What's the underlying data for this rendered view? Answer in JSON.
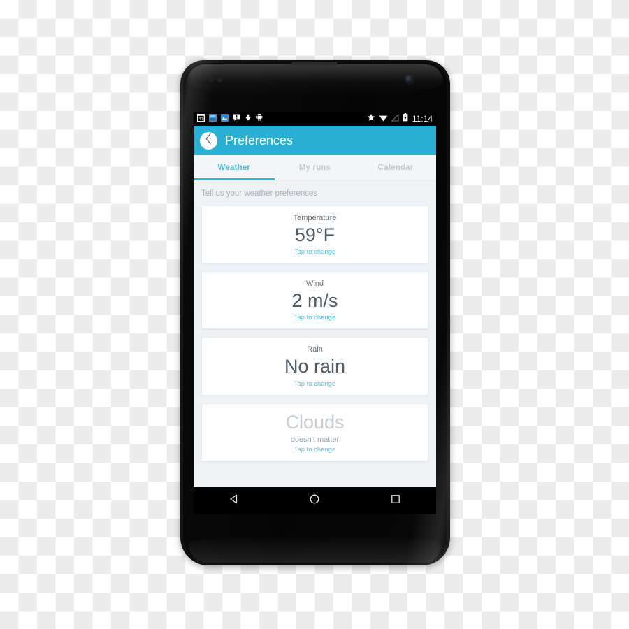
{
  "device": {
    "type": "android-smartphone",
    "earpiece": "earpiece-speaker",
    "camera": "front-camera"
  },
  "statusbar": {
    "clock": "11:14",
    "left_icons": [
      "calendar-icon",
      "download-manager-icon",
      "photos-icon",
      "alert-message-icon",
      "download-arrow-icon",
      "android-robot-icon"
    ],
    "right_icons": [
      "star-icon",
      "wifi-icon",
      "signal-icon",
      "battery-charging-icon"
    ]
  },
  "appbar": {
    "back_icon": "chevron-left-icon",
    "title": "Preferences",
    "accent_color": "#29b0d4"
  },
  "tabs": {
    "items": [
      {
        "label": "Weather",
        "active": true
      },
      {
        "label": "My runs",
        "active": false
      },
      {
        "label": "Calendar",
        "active": false
      }
    ],
    "active_color": "#41bfe5",
    "inactive_color": "#c2c9cf"
  },
  "content": {
    "hint": "Tell us your weather preferences",
    "action_label": "Tap to change",
    "action_color": "#4ec6ef",
    "cards": [
      {
        "name": "temperature",
        "label": "Temperature",
        "value": "59°F",
        "action": "Tap to change",
        "muted": false
      },
      {
        "name": "wind",
        "label": "Wind",
        "value": "2 m/s",
        "action": "Tap to change",
        "muted": false
      },
      {
        "name": "rain",
        "label": "Rain",
        "value": "No rain",
        "action": "Tap to change",
        "muted": false
      },
      {
        "name": "clouds",
        "label": "",
        "value": "Clouds",
        "sub": "doesn't matter",
        "action": "Tap to change",
        "muted": true
      }
    ]
  },
  "navbar": {
    "buttons": [
      {
        "name": "back-nav-button",
        "icon": "triangle-left-icon"
      },
      {
        "name": "home-nav-button",
        "icon": "circle-icon"
      },
      {
        "name": "recents-nav-button",
        "icon": "square-icon"
      }
    ]
  }
}
